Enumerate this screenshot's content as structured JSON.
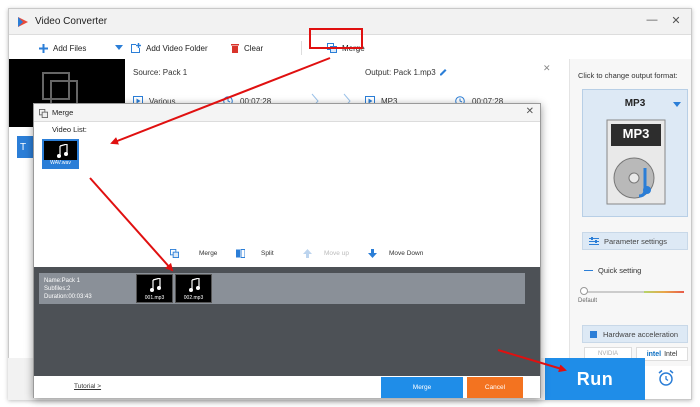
{
  "window": {
    "title": "Video Converter",
    "min": "—",
    "close": "✕"
  },
  "toolbar": {
    "add_files": "Add Files",
    "add_video_folder": "Add Video Folder",
    "clear": "Clear",
    "merge": "Merge"
  },
  "task": {
    "source": "Source: Pack 1",
    "output": "Output: Pack 1.mp3",
    "source_format": "Various",
    "source_duration": "00:07:28",
    "output_format": "MP3",
    "output_duration": "00:07:28"
  },
  "right_panel": {
    "hint": "Click to change output format:",
    "format": "MP3",
    "format_badge": "MP3",
    "parameter_settings": "Parameter settings",
    "quick_setting": "Quick setting",
    "default_label": "Default",
    "hardware_acceleration": "Hardware acceleration",
    "nvidia": "NVIDIA",
    "intel": "Intel"
  },
  "run": {
    "label": "Run"
  },
  "dialog": {
    "title": "Merge",
    "video_list_label": "Video List:",
    "video_item_caption": "WAV.wav",
    "actions": {
      "merge": "Merge",
      "split": "Split",
      "move_up": "Move up",
      "move_down": "Move Down"
    },
    "pack": {
      "name": "Name:Pack 1",
      "subfiles": "Subfiles:2",
      "duration": "Duration:00:03:43",
      "clips": [
        "001.mp3",
        "002.mp3"
      ]
    },
    "tutorial": "Tutorial >",
    "merge_button": "Merge",
    "cancel_button": "Cancel"
  },
  "colors": {
    "accent": "#1f8de8",
    "cancel": "#f37320",
    "annotation": "#e01010"
  }
}
